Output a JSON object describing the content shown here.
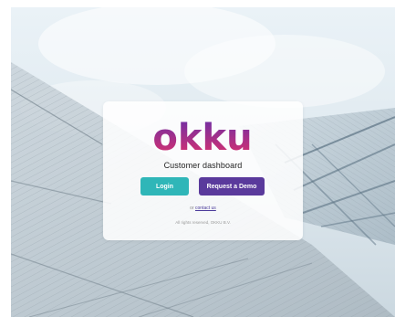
{
  "brand": {
    "logo_text": "okku",
    "gradient_start": "#6a2fa8",
    "gradient_end": "#e0306a"
  },
  "card": {
    "subtitle": "Customer dashboard",
    "login_label": "Login",
    "demo_label": "Request a Demo",
    "contact_prefix": "or",
    "contact_link": "contact us",
    "rights_text": "All rights reserved, OKKU B.V."
  },
  "colors": {
    "login_button": "#2fb6b8",
    "demo_button": "#5a3a9c",
    "link": "#4a3a9a"
  },
  "background": {
    "image_subject": "glass-building-photo"
  }
}
